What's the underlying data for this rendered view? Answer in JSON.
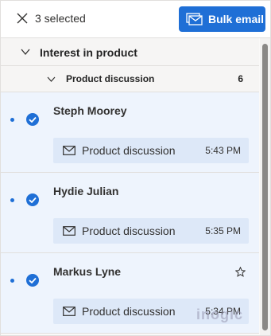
{
  "header": {
    "selected_text": "3 selected",
    "bulk_email_label": "Bulk email",
    "accent_color": "#1f6fd6"
  },
  "group": {
    "title": "Interest in product",
    "subgroup": {
      "title": "Product discussion",
      "count": "6"
    }
  },
  "items": [
    {
      "name": "Steph Moorey",
      "subject": "Product discussion",
      "time": "5:43 PM",
      "selected": true,
      "unread": true,
      "starred": false
    },
    {
      "name": "Hydie Julian",
      "subject": "Product discussion",
      "time": "5:35 PM",
      "selected": true,
      "unread": true,
      "starred": false
    },
    {
      "name": "Markus Lyne",
      "subject": "Product discussion",
      "time": "5:34 PM",
      "selected": true,
      "unread": true,
      "starred": false,
      "show_star_icon": true
    }
  ],
  "watermark": "inogic",
  "icons": [
    "close-icon",
    "bulk-email-icon",
    "chevron-down-icon",
    "checkmark-circle-icon",
    "star-icon",
    "mail-icon"
  ]
}
